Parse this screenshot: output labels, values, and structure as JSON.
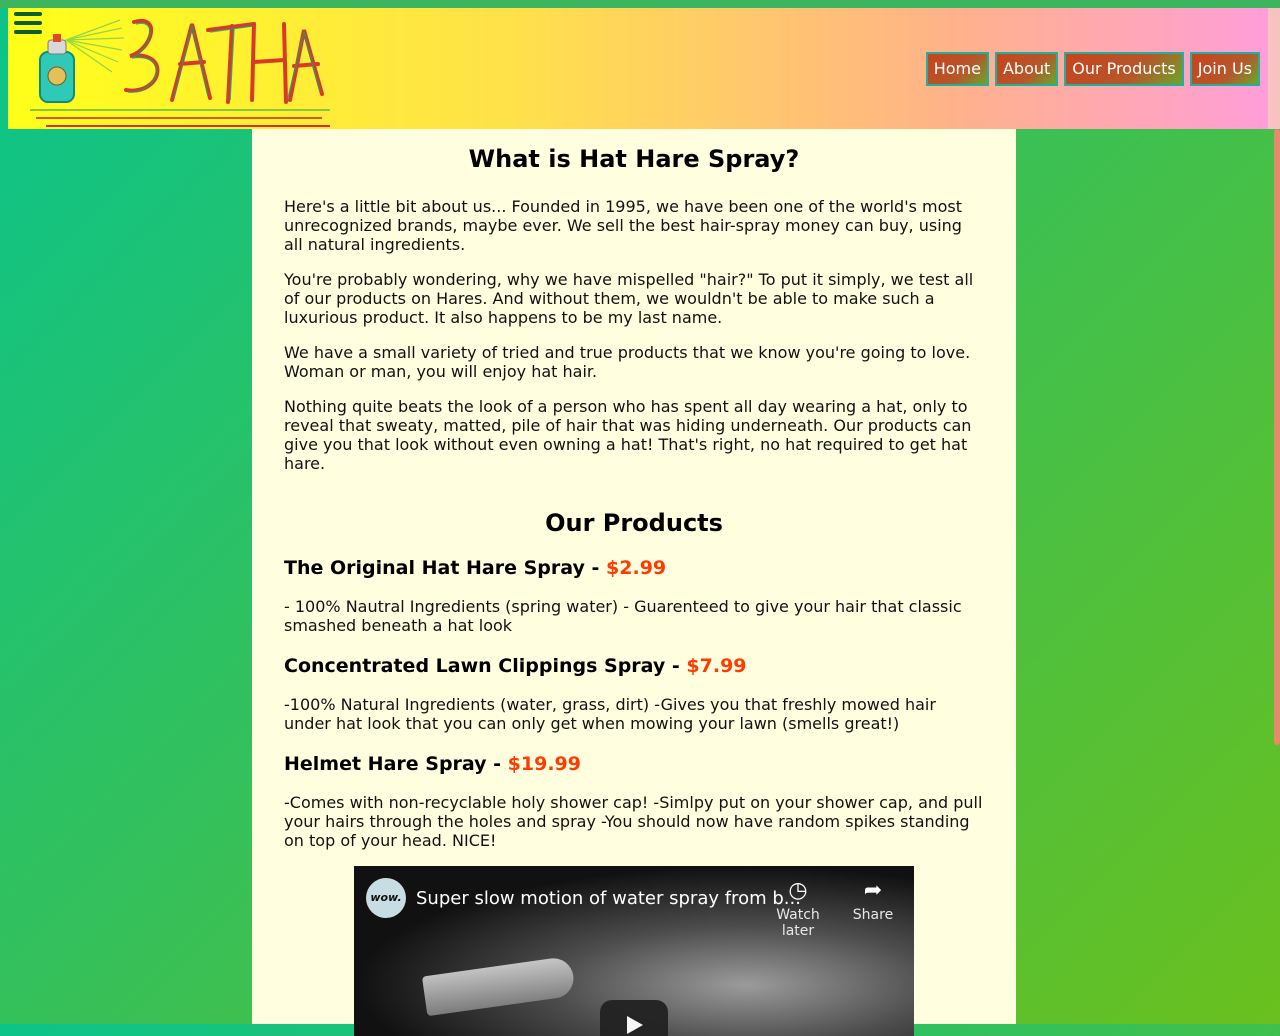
{
  "header": {
    "menu_icon": "hamburger-menu-icon",
    "logo_text": "HATHAR",
    "nav": [
      "Home",
      "About",
      "Our Products",
      "Join Us"
    ]
  },
  "about": {
    "title": "What is Hat Hare Spray?",
    "paragraphs": [
      "Here's a little bit about us... Founded in 1995, we have been one of the world's most unrecognized brands, maybe ever. We sell the best hair-spray money can buy, using all natural ingredients.",
      "You're probably wondering, why we have mispelled \"hair?\" To put it simply, we test all of our products on Hares. And without them, we wouldn't be able to make such a luxurious product. It also happens to be my last name.",
      "We have a small variety of tried and true products that we know you're going to love. Woman or man, you will enjoy hat hair.",
      "Nothing quite beats the look of a person who has spent all day wearing a hat, only to reveal that sweaty, matted, pile of hair that was hiding underneath. Our products can give you that look without even owning a hat! That's right, no hat required to get hat hare."
    ]
  },
  "products": {
    "title": "Our Products",
    "items": [
      {
        "name": "The Original Hat Hare Spray - ",
        "price": "$2.99",
        "description": "- 100% Nautral Ingredients (spring water) - Guarenteed to give your hair that classic smashed beneath a hat look"
      },
      {
        "name": "Concentrated Lawn Clippings Spray - ",
        "price": "$7.99",
        "description": "-100% Natural Ingredients (water, grass, dirt) -Gives you that freshly mowed hair under hat look that you can only get when mowing your lawn (smells great!)"
      },
      {
        "name": "Helmet Hare Spray - ",
        "price": "$19.99",
        "description": "-Comes with non-recyclable holy shower cap! -Simlpy put on your shower cap, and pull your hairs through the holes and spray -You should now have random spikes standing on top of your head. NICE!"
      }
    ]
  },
  "video": {
    "channel_avatar": "wow.",
    "title": "Super slow motion of water spray from b...",
    "watch_later": "Watch later",
    "share": "Share",
    "icons": {
      "watch_later": "clock-icon",
      "share": "share-arrow-icon",
      "play": "play-icon"
    }
  },
  "colors": {
    "price": "#ff3c00",
    "content_bg": "#ffffe0",
    "nav_border": "#1fb0a0"
  }
}
